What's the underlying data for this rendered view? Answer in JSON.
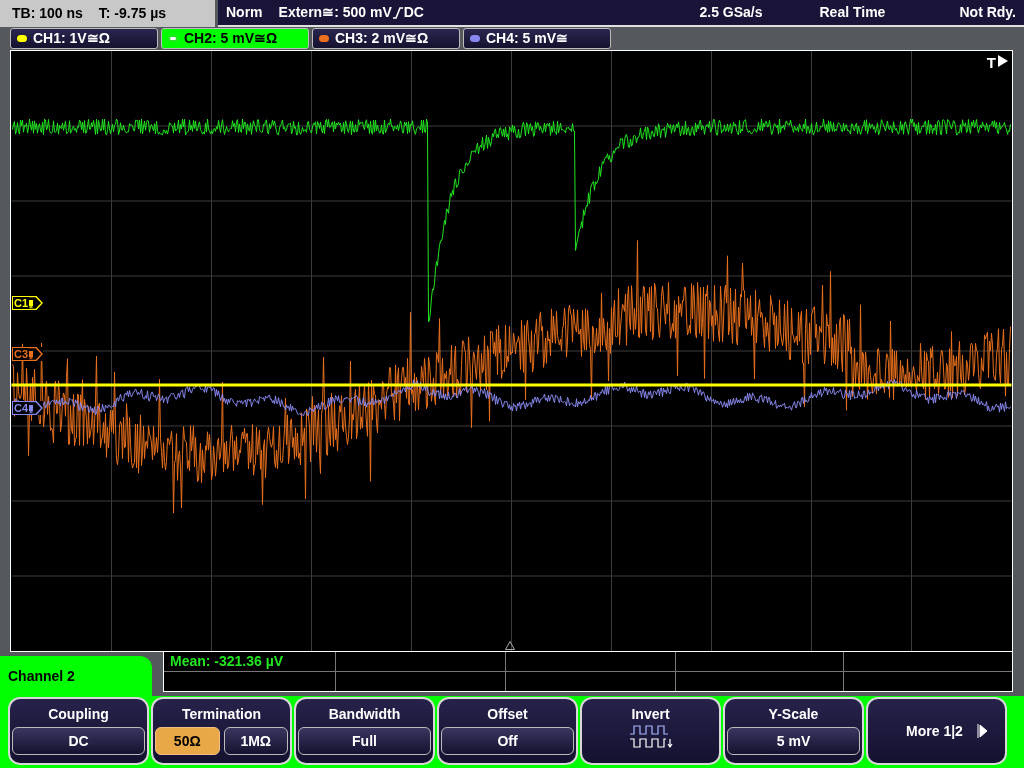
{
  "status_bar": {
    "timebase": "TB: 100 ns",
    "trigger_offset": "T: -9.75 µs",
    "trigger_mode": "Norm",
    "trigger_source": "Extern≅: 500 mV",
    "trigger_coupling": "DC",
    "sample_rate": "2.5 GSa/s",
    "acquisition": "Real Time",
    "state": "Not Rdy."
  },
  "channels": [
    {
      "label": "CH1: 1V≅Ω",
      "color": "#ffff00",
      "selected": false
    },
    {
      "label": "CH2: 5 mV≅Ω",
      "color": "#22e622",
      "selected": true
    },
    {
      "label": "CH3: 2 mV≅Ω",
      "color": "#e8701e",
      "selected": false
    },
    {
      "label": "CH4: 5 mV≅",
      "color": "#8888ee",
      "selected": false
    }
  ],
  "waveform": {
    "trigger_label": "T",
    "markers": [
      {
        "label": "C1",
        "color": "#ffff00"
      },
      {
        "label": "C3",
        "color": "#e8701e"
      },
      {
        "label": "C4",
        "color": "#8888ee"
      }
    ]
  },
  "measurement": {
    "text": "Mean: -321.36 µV"
  },
  "menu": {
    "title": "Channel 2",
    "softkeys": [
      {
        "kind": "options",
        "title": "Coupling",
        "options": [
          {
            "label": "DC",
            "selected": false
          }
        ]
      },
      {
        "kind": "options",
        "title": "Termination",
        "options": [
          {
            "label": "50Ω",
            "selected": true
          },
          {
            "label": "1MΩ",
            "selected": false
          }
        ]
      },
      {
        "kind": "options",
        "title": "Bandwidth",
        "options": [
          {
            "label": "Full",
            "selected": false
          }
        ]
      },
      {
        "kind": "options",
        "title": "Offset",
        "options": [
          {
            "label": "Off",
            "selected": false
          }
        ]
      },
      {
        "kind": "icon",
        "title": "Invert"
      },
      {
        "kind": "options",
        "title": "Y-Scale",
        "options": [
          {
            "label": "5 mV",
            "selected": false
          }
        ]
      },
      {
        "kind": "more",
        "label": "More 1|2"
      }
    ]
  }
}
